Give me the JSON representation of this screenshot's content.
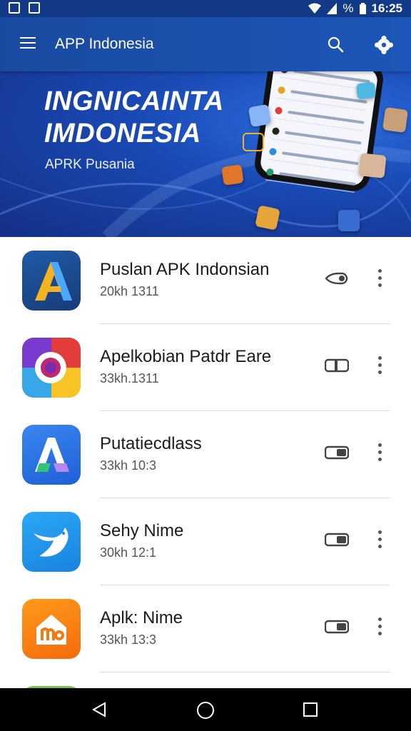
{
  "status": {
    "time": "16:25",
    "battery": "%"
  },
  "appbar": {
    "title": "APP Indonesia"
  },
  "banner": {
    "title_line1": "INGNICAINTA",
    "title_line2": "IMDONESIA",
    "subtitle": "APRK Pusania"
  },
  "apps": [
    {
      "name": "Puslan APK Indonsian",
      "meta": "20kh 1311",
      "icon": "arrow-a-icon"
    },
    {
      "name": "Apelkobian Patdr Eare",
      "meta": "33kh.1311",
      "icon": "chrome-like-icon"
    },
    {
      "name": "Putatiecdlass",
      "meta": "33kh 10:3",
      "icon": "a-letter-icon"
    },
    {
      "name": "Sehy Nime",
      "meta": "30kh 12:1",
      "icon": "bird-icon"
    },
    {
      "name": "Aplk: Nime",
      "meta": "33kh 13:3",
      "icon": "home-m-icon"
    }
  ],
  "colors": {
    "appbar": "#1c56b8",
    "banner": "#1a4ab5",
    "statusbar": "#123a86"
  }
}
